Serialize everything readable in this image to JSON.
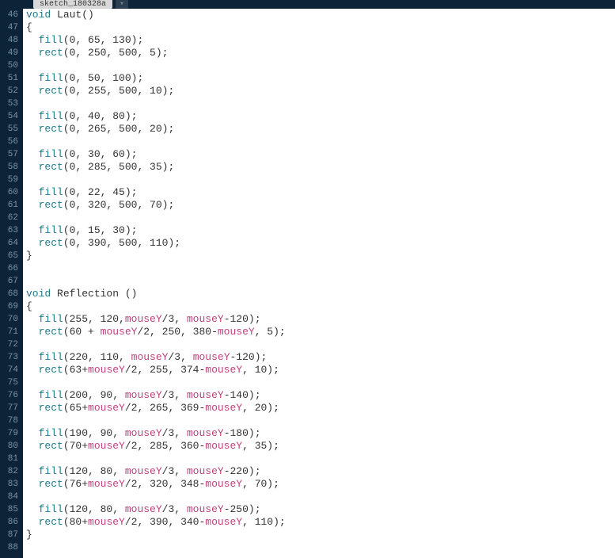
{
  "tab": {
    "label": "sketch_180328a"
  },
  "first_line_no": 46,
  "lines": [
    [
      [
        "type",
        "void"
      ],
      [
        "text",
        " Laut()"
      ]
    ],
    [
      [
        "text",
        "{"
      ]
    ],
    [
      [
        "text",
        "  "
      ],
      [
        "call",
        "fill"
      ],
      [
        "text",
        "(0, 65, 130);"
      ]
    ],
    [
      [
        "text",
        "  "
      ],
      [
        "call",
        "rect"
      ],
      [
        "text",
        "(0, 250, 500, 5);"
      ]
    ],
    [],
    [
      [
        "text",
        "  "
      ],
      [
        "call",
        "fill"
      ],
      [
        "text",
        "(0, 50, 100);"
      ]
    ],
    [
      [
        "text",
        "  "
      ],
      [
        "call",
        "rect"
      ],
      [
        "text",
        "(0, 255, 500, 10);"
      ]
    ],
    [],
    [
      [
        "text",
        "  "
      ],
      [
        "call",
        "fill"
      ],
      [
        "text",
        "(0, 40, 80);"
      ]
    ],
    [
      [
        "text",
        "  "
      ],
      [
        "call",
        "rect"
      ],
      [
        "text",
        "(0, 265, 500, 20);"
      ]
    ],
    [],
    [
      [
        "text",
        "  "
      ],
      [
        "call",
        "fill"
      ],
      [
        "text",
        "(0, 30, 60);"
      ]
    ],
    [
      [
        "text",
        "  "
      ],
      [
        "call",
        "rect"
      ],
      [
        "text",
        "(0, 285, 500, 35);"
      ]
    ],
    [],
    [
      [
        "text",
        "  "
      ],
      [
        "call",
        "fill"
      ],
      [
        "text",
        "(0, 22, 45);"
      ]
    ],
    [
      [
        "text",
        "  "
      ],
      [
        "call",
        "rect"
      ],
      [
        "text",
        "(0, 320, 500, 70);"
      ]
    ],
    [],
    [
      [
        "text",
        "  "
      ],
      [
        "call",
        "fill"
      ],
      [
        "text",
        "(0, 15, 30);"
      ]
    ],
    [
      [
        "text",
        "  "
      ],
      [
        "call",
        "rect"
      ],
      [
        "text",
        "(0, 390, 500, 110);"
      ]
    ],
    [
      [
        "text",
        "}"
      ]
    ],
    [],
    [],
    [
      [
        "type",
        "void"
      ],
      [
        "text",
        " Reflection ()"
      ]
    ],
    [
      [
        "text",
        "{"
      ]
    ],
    [
      [
        "text",
        "  "
      ],
      [
        "call",
        "fill"
      ],
      [
        "text",
        "(255, 120,"
      ],
      [
        "var",
        "mouseY"
      ],
      [
        "text",
        "/3, "
      ],
      [
        "var",
        "mouseY"
      ],
      [
        "text",
        "-120);"
      ]
    ],
    [
      [
        "text",
        "  "
      ],
      [
        "call",
        "rect"
      ],
      [
        "text",
        "(60 + "
      ],
      [
        "var",
        "mouseY"
      ],
      [
        "text",
        "/2, 250, 380-"
      ],
      [
        "var",
        "mouseY"
      ],
      [
        "text",
        ", 5);"
      ]
    ],
    [],
    [
      [
        "text",
        "  "
      ],
      [
        "call",
        "fill"
      ],
      [
        "text",
        "(220, 110, "
      ],
      [
        "var",
        "mouseY"
      ],
      [
        "text",
        "/3, "
      ],
      [
        "var",
        "mouseY"
      ],
      [
        "text",
        "-120);"
      ]
    ],
    [
      [
        "text",
        "  "
      ],
      [
        "call",
        "rect"
      ],
      [
        "text",
        "(63+"
      ],
      [
        "var",
        "mouseY"
      ],
      [
        "text",
        "/2, 255, 374-"
      ],
      [
        "var",
        "mouseY"
      ],
      [
        "text",
        ", 10);"
      ]
    ],
    [],
    [
      [
        "text",
        "  "
      ],
      [
        "call",
        "fill"
      ],
      [
        "text",
        "(200, 90, "
      ],
      [
        "var",
        "mouseY"
      ],
      [
        "text",
        "/3, "
      ],
      [
        "var",
        "mouseY"
      ],
      [
        "text",
        "-140);"
      ]
    ],
    [
      [
        "text",
        "  "
      ],
      [
        "call",
        "rect"
      ],
      [
        "text",
        "(65+"
      ],
      [
        "var",
        "mouseY"
      ],
      [
        "text",
        "/2, 265, 369-"
      ],
      [
        "var",
        "mouseY"
      ],
      [
        "text",
        ", 20);"
      ]
    ],
    [],
    [
      [
        "text",
        "  "
      ],
      [
        "call",
        "fill"
      ],
      [
        "text",
        "(190, 90, "
      ],
      [
        "var",
        "mouseY"
      ],
      [
        "text",
        "/3, "
      ],
      [
        "var",
        "mouseY"
      ],
      [
        "text",
        "-180);"
      ]
    ],
    [
      [
        "text",
        "  "
      ],
      [
        "call",
        "rect"
      ],
      [
        "text",
        "(70+"
      ],
      [
        "var",
        "mouseY"
      ],
      [
        "text",
        "/2, 285, 360-"
      ],
      [
        "var",
        "mouseY"
      ],
      [
        "text",
        ", 35);"
      ]
    ],
    [],
    [
      [
        "text",
        "  "
      ],
      [
        "call",
        "fill"
      ],
      [
        "text",
        "(120, 80, "
      ],
      [
        "var",
        "mouseY"
      ],
      [
        "text",
        "/3, "
      ],
      [
        "var",
        "mouseY"
      ],
      [
        "text",
        "-220);"
      ]
    ],
    [
      [
        "text",
        "  "
      ],
      [
        "call",
        "rect"
      ],
      [
        "text",
        "(76+"
      ],
      [
        "var",
        "mouseY"
      ],
      [
        "text",
        "/2, 320, 348-"
      ],
      [
        "var",
        "mouseY"
      ],
      [
        "text",
        ", 70);"
      ]
    ],
    [],
    [
      [
        "text",
        "  "
      ],
      [
        "call",
        "fill"
      ],
      [
        "text",
        "(120, 80, "
      ],
      [
        "var",
        "mouseY"
      ],
      [
        "text",
        "/3, "
      ],
      [
        "var",
        "mouseY"
      ],
      [
        "text",
        "-250);"
      ]
    ],
    [
      [
        "text",
        "  "
      ],
      [
        "call",
        "rect"
      ],
      [
        "text",
        "(80+"
      ],
      [
        "var",
        "mouseY"
      ],
      [
        "text",
        "/2, 390, 340-"
      ],
      [
        "var",
        "mouseY"
      ],
      [
        "text",
        ", 110);"
      ]
    ],
    [
      [
        "text",
        "}"
      ]
    ],
    []
  ]
}
